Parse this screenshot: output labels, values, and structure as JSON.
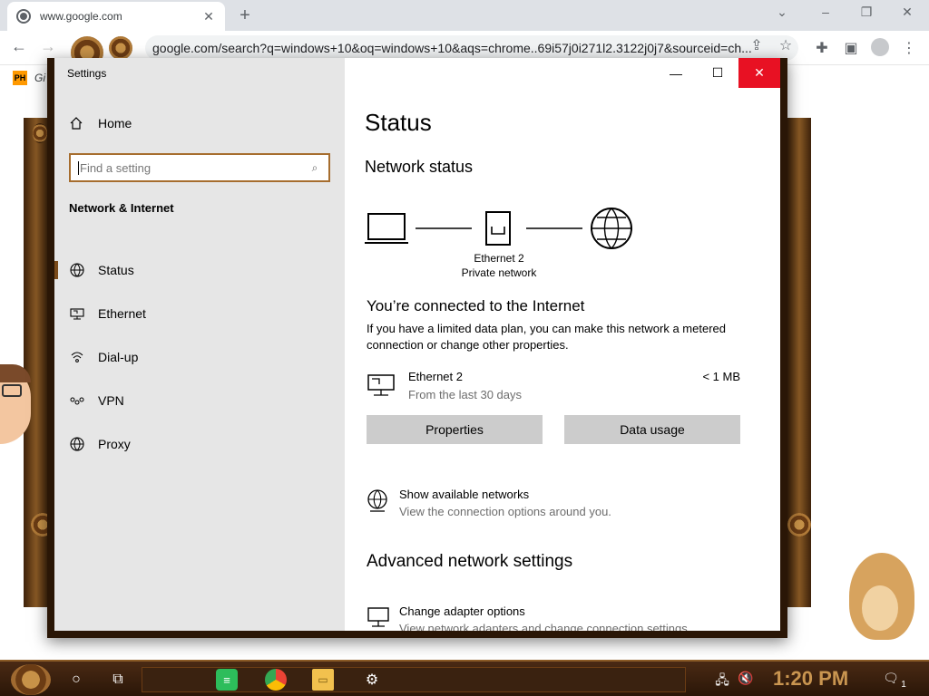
{
  "browser": {
    "tab_title": "www.google.com",
    "new_tab_glyph": "+",
    "url": "google.com/search?q=windows+10&oq=windows+10&aqs=chrome..69i57j0i271l2.3122j0j7&sourceid=ch...",
    "bookmark_badge": "PH",
    "bookmark_label": "Gi"
  },
  "settings": {
    "window_title": "Settings",
    "home_label": "Home",
    "search_placeholder": "Find a setting",
    "section_title": "Network & Internet",
    "nav": [
      {
        "label": "Status",
        "icon": "globe-status-icon"
      },
      {
        "label": "Ethernet",
        "icon": "ethernet-icon"
      },
      {
        "label": "Dial-up",
        "icon": "dialup-icon"
      },
      {
        "label": "VPN",
        "icon": "vpn-icon"
      },
      {
        "label": "Proxy",
        "icon": "globe-icon"
      }
    ],
    "active_nav": "Status",
    "content": {
      "title": "Status",
      "network_status": "Network status",
      "diagram_label_1": "Ethernet 2",
      "diagram_label_2": "Private network",
      "connected_heading": "You’re connected to the Internet",
      "connected_desc": "If you have a limited data plan, you can make this network a metered connection or change other properties.",
      "adapter_name": "Ethernet 2",
      "adapter_period": "From the last 30 days",
      "adapter_usage": "< 1 MB",
      "properties_button": "Properties",
      "data_usage_button": "Data usage",
      "show_networks_title": "Show available networks",
      "show_networks_sub": "View the connection options around you.",
      "advanced_heading": "Advanced network settings",
      "change_adapter_title": "Change adapter options",
      "change_adapter_sub": "View network adapters and change connection settings."
    }
  },
  "taskbar": {
    "clock": "1:20 PM",
    "notification_count": "1"
  },
  "colors": {
    "accent": "#a66d2e",
    "close_red": "#e81123",
    "button_gray": "#cccccc",
    "sidebar_bg": "#e6e6e6"
  }
}
